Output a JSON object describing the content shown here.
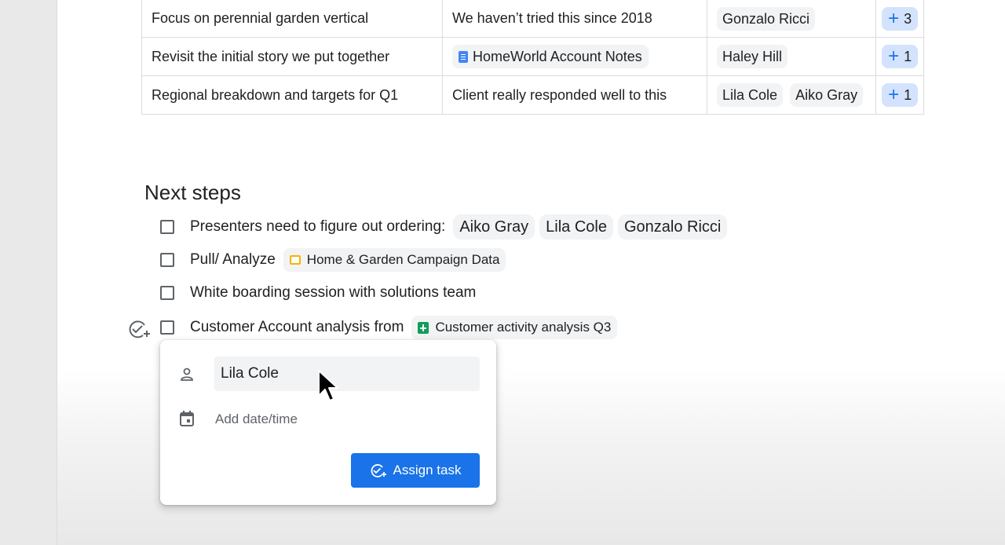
{
  "table": {
    "rows": [
      {
        "topic": "Focus on perennial garden vertical",
        "notes": "We haven’t tried this since 2018",
        "notes_is_file": false,
        "owners": [
          "Gonzalo Ricci"
        ],
        "votes": "3"
      },
      {
        "topic": "Revisit the initial story we put together",
        "notes": "HomeWorld Account Notes",
        "notes_is_file": true,
        "notes_icon": "docs-icon",
        "owners": [
          "Haley Hill"
        ],
        "votes": "1"
      },
      {
        "topic": "Regional breakdown and targets for Q1",
        "notes": "Client really responded well to this",
        "notes_is_file": false,
        "owners": [
          "Lila Cole",
          "Aiko Gray"
        ],
        "votes": "1"
      }
    ]
  },
  "next_steps": {
    "heading": "Next steps",
    "items": [
      {
        "text": "Presenters need to figure out ordering:",
        "people": [
          "Aiko Gray",
          "Lila Cole",
          "Gonzalo Ricci"
        ]
      },
      {
        "text": "Pull/ Analyze",
        "file": "Home & Garden Campaign Data",
        "file_icon": "slides-icon"
      },
      {
        "text": "White boarding session with solutions team"
      },
      {
        "text": "Customer Account analysis from",
        "file": "Customer activity analysis Q3",
        "file_icon": "sheets-icon"
      }
    ]
  },
  "assign_popup": {
    "assignee_value": "Lila Cole",
    "date_placeholder": "Add date/time",
    "button_label": "Assign task",
    "accent": "#1a73e8"
  }
}
